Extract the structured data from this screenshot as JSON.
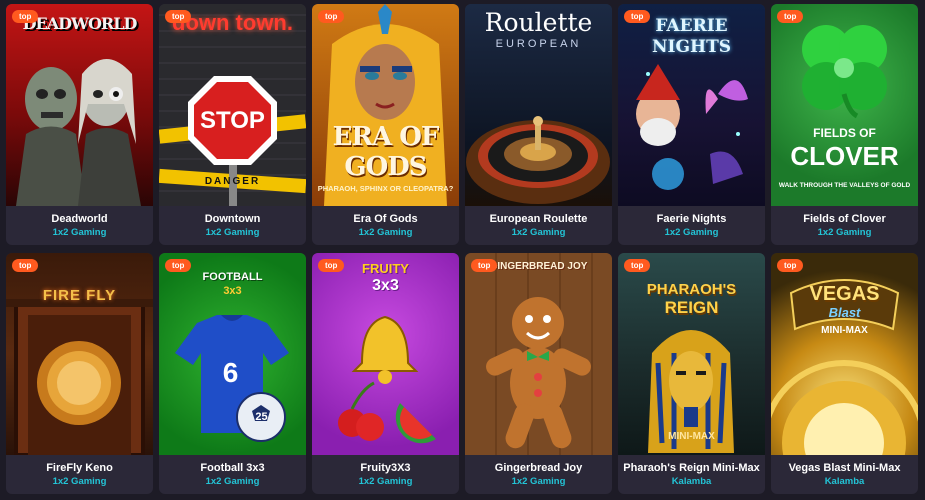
{
  "badge_label": "top",
  "games": [
    {
      "title": "Deadworld",
      "provider": "1x2 Gaming",
      "logo": "DEADWORLD"
    },
    {
      "title": "Downtown",
      "provider": "1x2 Gaming",
      "logo": "down town.",
      "sign": "STOP",
      "tape": "DANGER"
    },
    {
      "title": "Era Of Gods",
      "provider": "1x2 Gaming",
      "logo": "ERA OF GODS",
      "tagline": "PHARAOH, SPHINX OR CLEOPATRA?"
    },
    {
      "title": "European Roulette",
      "provider": "1x2 Gaming",
      "logo": "Roulette",
      "sublogo": "EUROPEAN"
    },
    {
      "title": "Faerie Nights",
      "provider": "1x2 Gaming",
      "logo": "FAERIE",
      "sublogo": "NIGHTS"
    },
    {
      "title": "Fields of Clover",
      "provider": "1x2 Gaming",
      "logo": "FIELDS OF",
      "sublogo": "CLOVER",
      "tagline": "WALK THROUGH THE VALLEYS OF GOLD"
    },
    {
      "title": "FireFly Keno",
      "provider": "1x2 Gaming",
      "logo": "FIRE FLY"
    },
    {
      "title": "Football 3x3",
      "provider": "1x2 Gaming",
      "logo": "FOOTBALL",
      "sublogo": "3x3",
      "shirt_number": "6",
      "ball_number": "25"
    },
    {
      "title": "Fruity3X3",
      "provider": "1x2 Gaming",
      "logo": "FRUITY",
      "sublogo": "3x3"
    },
    {
      "title": "Gingerbread Joy",
      "provider": "1x2 Gaming",
      "logo": "GINGERBREAD JOY"
    },
    {
      "title": "Pharaoh's Reign Mini-Max",
      "provider": "Kalamba",
      "logo": "PHARAOH'S",
      "sublogo": "REIGN",
      "tagline": "MINI-MAX"
    },
    {
      "title": "Vegas Blast Mini-Max",
      "provider": "Kalamba",
      "logo": "VEGAS",
      "sublogo": "Blast",
      "tagline": "MINI-MAX"
    }
  ]
}
